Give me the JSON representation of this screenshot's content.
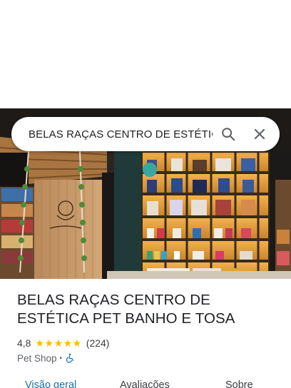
{
  "search": {
    "query": "BELAS RAÇAS CENTRO DE ESTÉTIC",
    "search_icon": "search-icon",
    "close_icon": "close-icon"
  },
  "place": {
    "name": "BELAS RAÇAS CENTRO DE ESTÉTICA PET BANHO E TOSA",
    "rating": "4,8",
    "stars": 5,
    "review_count": "(224)",
    "category": "Pet Shop",
    "separator": "•",
    "accessibility_icon": "wheelchair-icon"
  },
  "tabs": [
    {
      "label": "Visão geral",
      "active": true
    },
    {
      "label": "Avaliações",
      "active": false
    },
    {
      "label": "Sobre",
      "active": false
    }
  ],
  "colors": {
    "star": "#fbbc04",
    "active_tab": "#1a73a8",
    "accessibility": "#1a73e8"
  }
}
